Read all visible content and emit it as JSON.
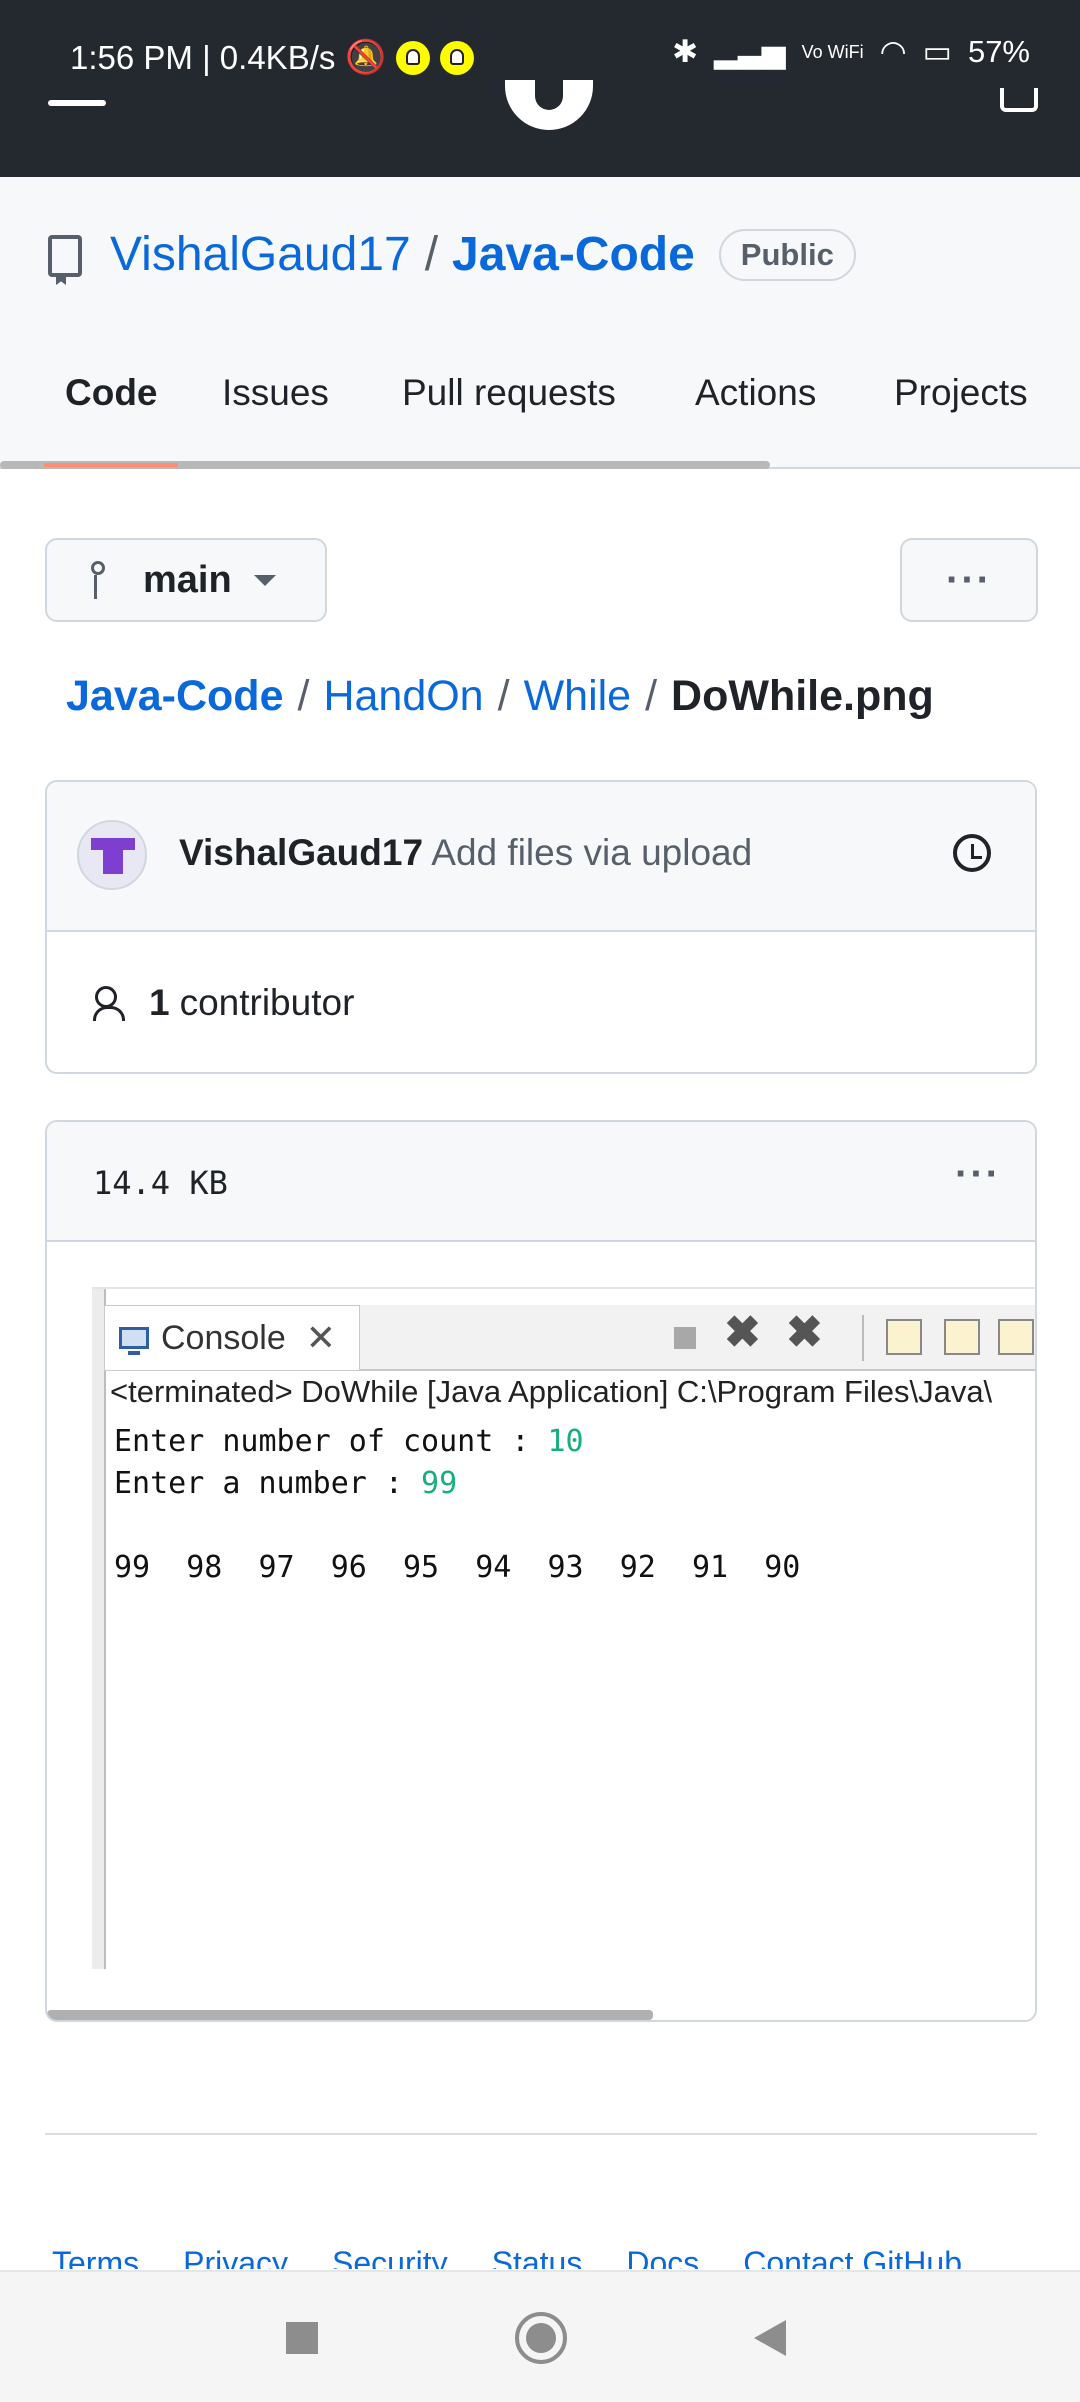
{
  "status_bar": {
    "time_speed": "1:56 PM | 0.4KB/s",
    "network_label": "Vo WiFi",
    "battery": "57%"
  },
  "repo": {
    "owner": "VishalGaud17",
    "separator": "/",
    "name": "Java-Code",
    "visibility": "Public"
  },
  "tabs": [
    "Code",
    "Issues",
    "Pull requests",
    "Actions",
    "Projects"
  ],
  "branch": {
    "label": "main"
  },
  "more_label": "···",
  "breadcrumb": {
    "items": [
      "Java-Code",
      "HandOn",
      "While"
    ],
    "sep": "/",
    "current": "DoWhile.png"
  },
  "commit": {
    "author": "VishalGaud17",
    "message": "Add files via upload"
  },
  "contributors": {
    "count": "1",
    "label": "contributor"
  },
  "file": {
    "size": "14.4 KB"
  },
  "console": {
    "tab_label": "Console",
    "terminated_line": "<terminated> DoWhile [Java Application] C:\\Program Files\\Java\\",
    "prompt_count": "Enter number of count : ",
    "input_count": "10",
    "prompt_number": "Enter a number : ",
    "input_number": "99",
    "output": "99  98  97  96  95  94  93  92  91  90"
  },
  "footer": {
    "links": [
      "Terms",
      "Privacy",
      "Security",
      "Status",
      "Docs",
      "Contact GitHub"
    ]
  },
  "colors": {
    "link": "#0969da",
    "header_bg": "#24292f",
    "console_input": "#17b07a",
    "tab_underline": "#fd8c73"
  }
}
